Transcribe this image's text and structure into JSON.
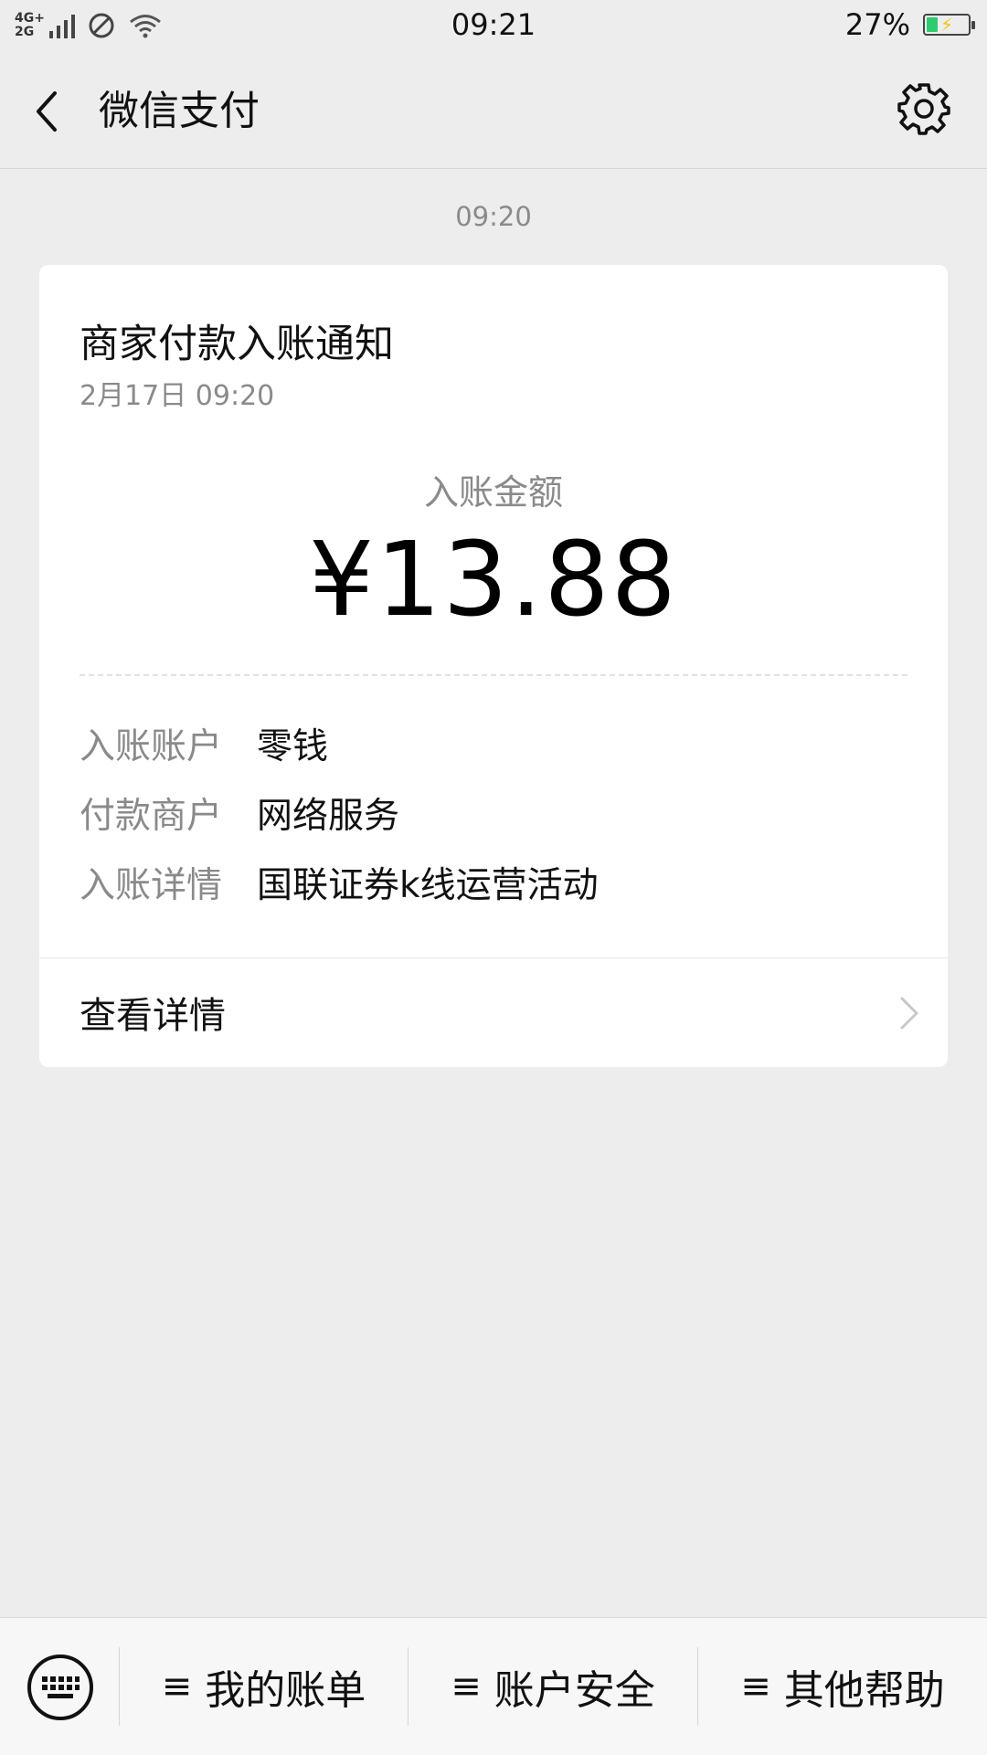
{
  "status_bar": {
    "network": "4G+ 2G",
    "time": "09:21",
    "battery_percent": "27%",
    "battery_level": 0.27
  },
  "nav": {
    "title": "微信支付"
  },
  "message": {
    "time": "09:20"
  },
  "card": {
    "title": "商家付款入账通知",
    "date": "2月17日  09:20",
    "amount_label": "入账金额",
    "amount": "¥13.88",
    "rows": [
      {
        "key": "入账账户",
        "value": "零钱"
      },
      {
        "key": "付款商户",
        "value": "网络服务"
      },
      {
        "key": "入账详情",
        "value": "国联证券k线运营活动"
      }
    ],
    "detail_link": "查看详情"
  },
  "bottom_menu": {
    "items": [
      {
        "label": "我的账单"
      },
      {
        "label": "账户安全"
      },
      {
        "label": "其他帮助"
      }
    ]
  },
  "colors": {
    "background": "#ededed",
    "card": "#ffffff",
    "secondary_text": "#8a8a8a",
    "battery": "#2ecc71"
  }
}
